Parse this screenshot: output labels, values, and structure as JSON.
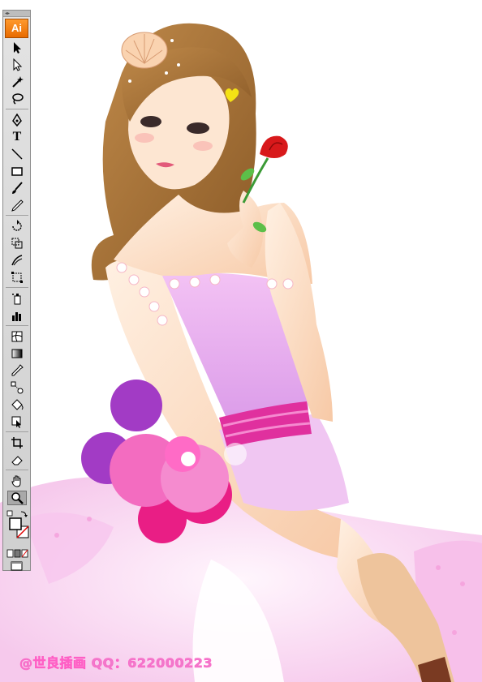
{
  "app": {
    "logo": "Ai",
    "name": "Adobe Illustrator"
  },
  "toolbar": {
    "tools": [
      "selection-tool",
      "direct-selection-tool",
      "magic-wand-tool",
      "lasso-tool",
      "pen-tool",
      "type-tool",
      "line-segment-tool",
      "rectangle-tool",
      "paintbrush-tool",
      "pencil-tool",
      "rotate-tool",
      "scale-tool",
      "warp-tool",
      "free-transform-tool",
      "symbol-sprayer-tool",
      "column-graph-tool",
      "mesh-tool",
      "gradient-tool",
      "eyedropper-tool",
      "blend-tool",
      "live-paint-bucket-tool",
      "live-paint-selection-tool",
      "slice-tool",
      "eraser-tool",
      "hand-tool",
      "zoom-tool"
    ],
    "active_tool": "zoom-tool",
    "type_tool_glyph": "T"
  },
  "artwork": {
    "subject": "girl in pink dress holding rose",
    "colors": {
      "hair": "#a8743a",
      "dress": "#e9a8f0",
      "sash": "#e0309e",
      "skin": "#fde0c8",
      "rose": "#d8191b"
    }
  },
  "watermark": {
    "text": "@世良插画 QQ：622000223"
  }
}
